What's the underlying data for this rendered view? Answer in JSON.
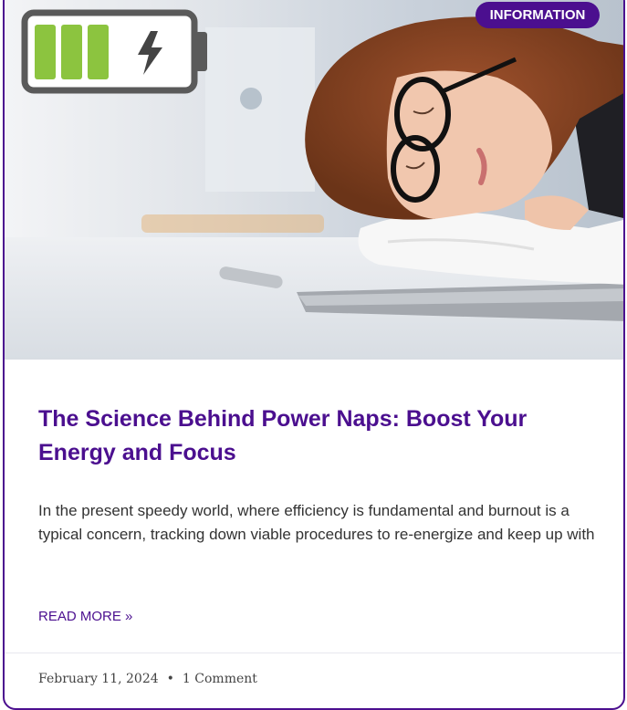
{
  "post": {
    "category": "Information",
    "title": "The Science Behind Power Naps: Boost Your Energy and Focus",
    "excerpt": "In the present speedy world, where efficiency is fundamental and burnout is a typical concern, tracking down viable procedures to re-energize and keep up with",
    "read_more": "Read More »",
    "date": "February 11, 2024",
    "separator": "•",
    "comments": "1 Comment"
  },
  "image": {
    "icon": "battery-charging-icon",
    "battery_fill_color": "#8cc43f",
    "battery_frame_color": "#5a5a5a"
  },
  "colors": {
    "accent": "#4b0f8f",
    "text": "#333333"
  }
}
